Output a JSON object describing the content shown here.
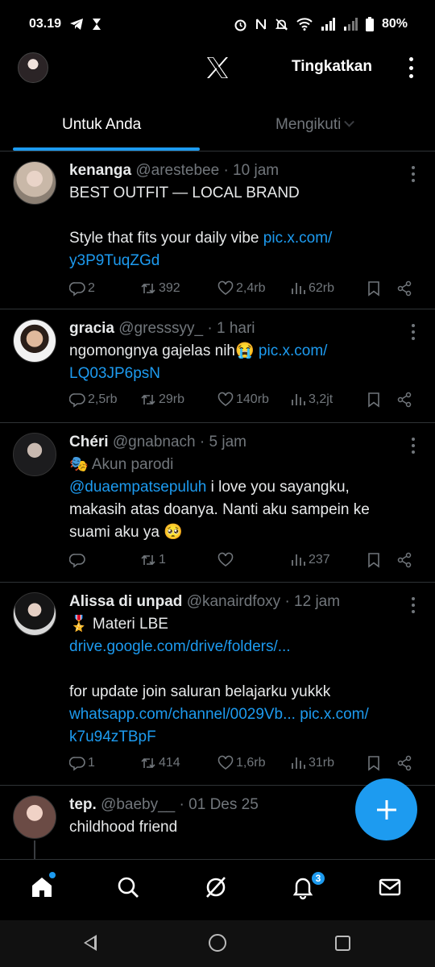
{
  "status_bar": {
    "time": "03.19",
    "battery": "80%"
  },
  "header": {
    "upgrade_label": "Tingkatkan"
  },
  "tabs": [
    {
      "label": "Untuk Anda"
    },
    {
      "label": "Mengikuti"
    }
  ],
  "colors": {
    "accent": "#1d9bf0",
    "muted": "#71767b",
    "background": "#000000",
    "text": "#e7e9ea"
  },
  "posts": [
    {
      "name": "kenanga",
      "handle": "@arestebee",
      "time": "· 10 jam",
      "lines": [
        "BEST OUTFIT — LOCAL BRAND",
        "",
        "Style that fits your daily vibe "
      ],
      "link1": "pic.x.com/",
      "link2": "y3P9TuqZGd",
      "replies": "2",
      "reposts": "392",
      "likes": "2,4rb",
      "views": "62rb"
    },
    {
      "name": "gracia",
      "handle": "@gresssyy_",
      "time": "· 1 hari",
      "text": "ngomongnya gajelas nih😭 ",
      "link1": "pic.x.com/",
      "link2": "LQ03JP6psN",
      "replies": "2,5rb",
      "reposts": "29rb",
      "likes": "140rb",
      "views": "3,2jt"
    },
    {
      "name": "Chéri",
      "handle": "@gnabnach",
      "time": "· 5 jam",
      "parody": "🎭 Akun parodi",
      "mention": "@duaempatsepuluh",
      "text": " i love you sayangku, makasih atas doanya. Nanti aku sampein ke suami aku ya 🥺",
      "replies": "",
      "reposts": "1",
      "likes": "",
      "views": "237"
    },
    {
      "name": "Alissa di unpad",
      "handle": "@kanairdfoxy",
      "time": "· 12 jam",
      "line1": "🎖️ Materi LBE",
      "link_drive": "drive.google.com/drive/folders/...",
      "line2": "for update join saluran belajarku yukkk",
      "link_wa": "whatsapp.com/channel/0029Vb...",
      "link_pic1": " pic.x.com/",
      "link_pic2": "k7u94zTBpF",
      "replies": "1",
      "reposts": "414",
      "likes": "1,6rb",
      "views": "31rb"
    },
    {
      "name": "tep.",
      "handle": "@baeby__",
      "time": "· 01 Des 25",
      "text": "childhood friend"
    }
  ],
  "nav": {
    "notifications_badge": "3"
  },
  "icons": [
    "x-logo-icon",
    "more-vertical-icon",
    "reply-icon",
    "repost-icon",
    "like-icon",
    "views-icon",
    "bookmark-icon",
    "share-icon",
    "home-icon",
    "search-icon",
    "grok-icon",
    "bell-icon",
    "mail-icon",
    "plus-icon"
  ]
}
